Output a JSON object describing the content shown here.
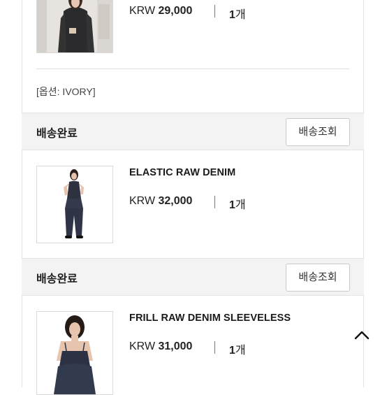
{
  "orders": [
    {
      "price_currency": "KRW",
      "price_amount": "29,000",
      "qty_number": "1",
      "qty_unit": "개",
      "option": "[옵션: IVORY]",
      "image": "model-black-jacket-photo"
    },
    {
      "status": "배송완료",
      "track_label": "배송조회",
      "name": "ELASTIC RAW DENIM",
      "price_currency": "KRW",
      "price_amount": "32,000",
      "qty_number": "1",
      "qty_unit": "개",
      "image": "model-denim-set-photo"
    },
    {
      "status": "배송완료",
      "track_label": "배송조회",
      "name": "FRILL RAW DENIM SLEEVELESS",
      "price_currency": "KRW",
      "price_amount": "31,000",
      "qty_number": "1",
      "qty_unit": "개",
      "image": "model-frill-top-photo"
    }
  ],
  "scroll_top_icon": "chevron-up-icon"
}
